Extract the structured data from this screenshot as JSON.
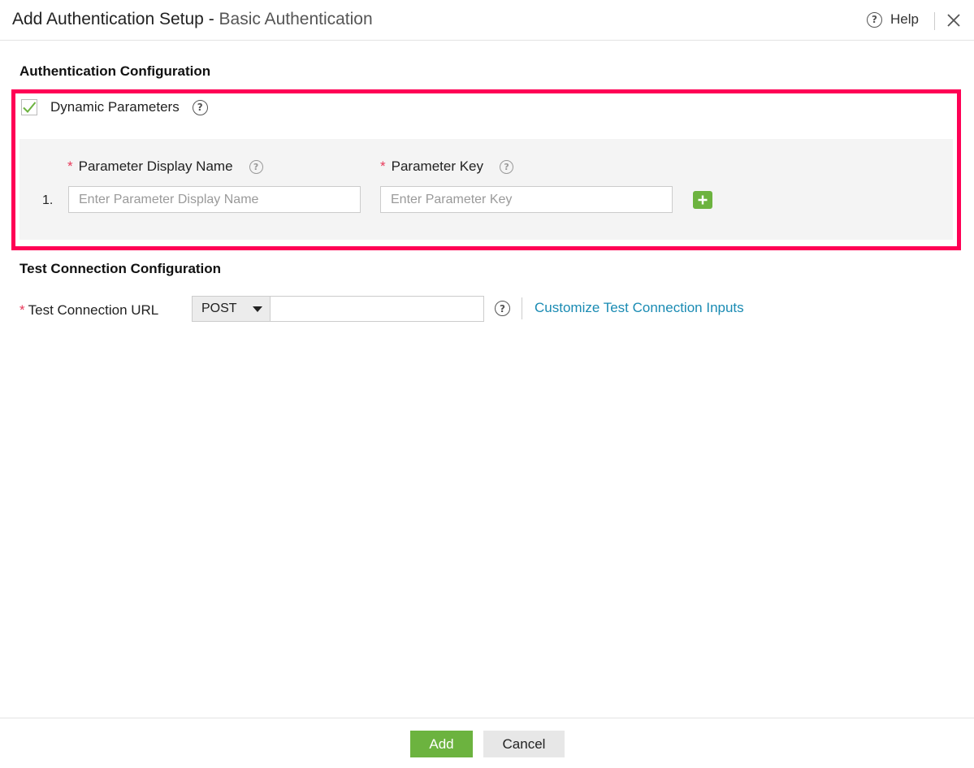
{
  "header": {
    "title": "Add Authentication Setup",
    "separator": " - ",
    "subtitle": "Basic Authentication",
    "help_label": "Help"
  },
  "auth_config": {
    "section_title": "Authentication Configuration",
    "dynamic_parameters": {
      "label": "Dynamic Parameters",
      "checked": true
    },
    "params": {
      "display_name_label": "Parameter Display Name",
      "key_label": "Parameter Key",
      "required_marker": "*",
      "rows": [
        {
          "index": "1.",
          "display_name_value": "",
          "display_name_placeholder": "Enter Parameter Display Name",
          "key_value": "",
          "key_placeholder": "Enter Parameter Key"
        }
      ]
    }
  },
  "test_config": {
    "section_title": "Test Connection Configuration",
    "url_label": "Test Connection URL",
    "required_marker": "*",
    "method": "POST",
    "url_value": "",
    "customize_link": "Customize Test Connection Inputs"
  },
  "footer": {
    "add_label": "Add",
    "cancel_label": "Cancel"
  },
  "colors": {
    "accent_green": "#6cb33f",
    "highlight_border": "#ff0055",
    "link": "#1a8bb3",
    "required": "#e8395a"
  }
}
